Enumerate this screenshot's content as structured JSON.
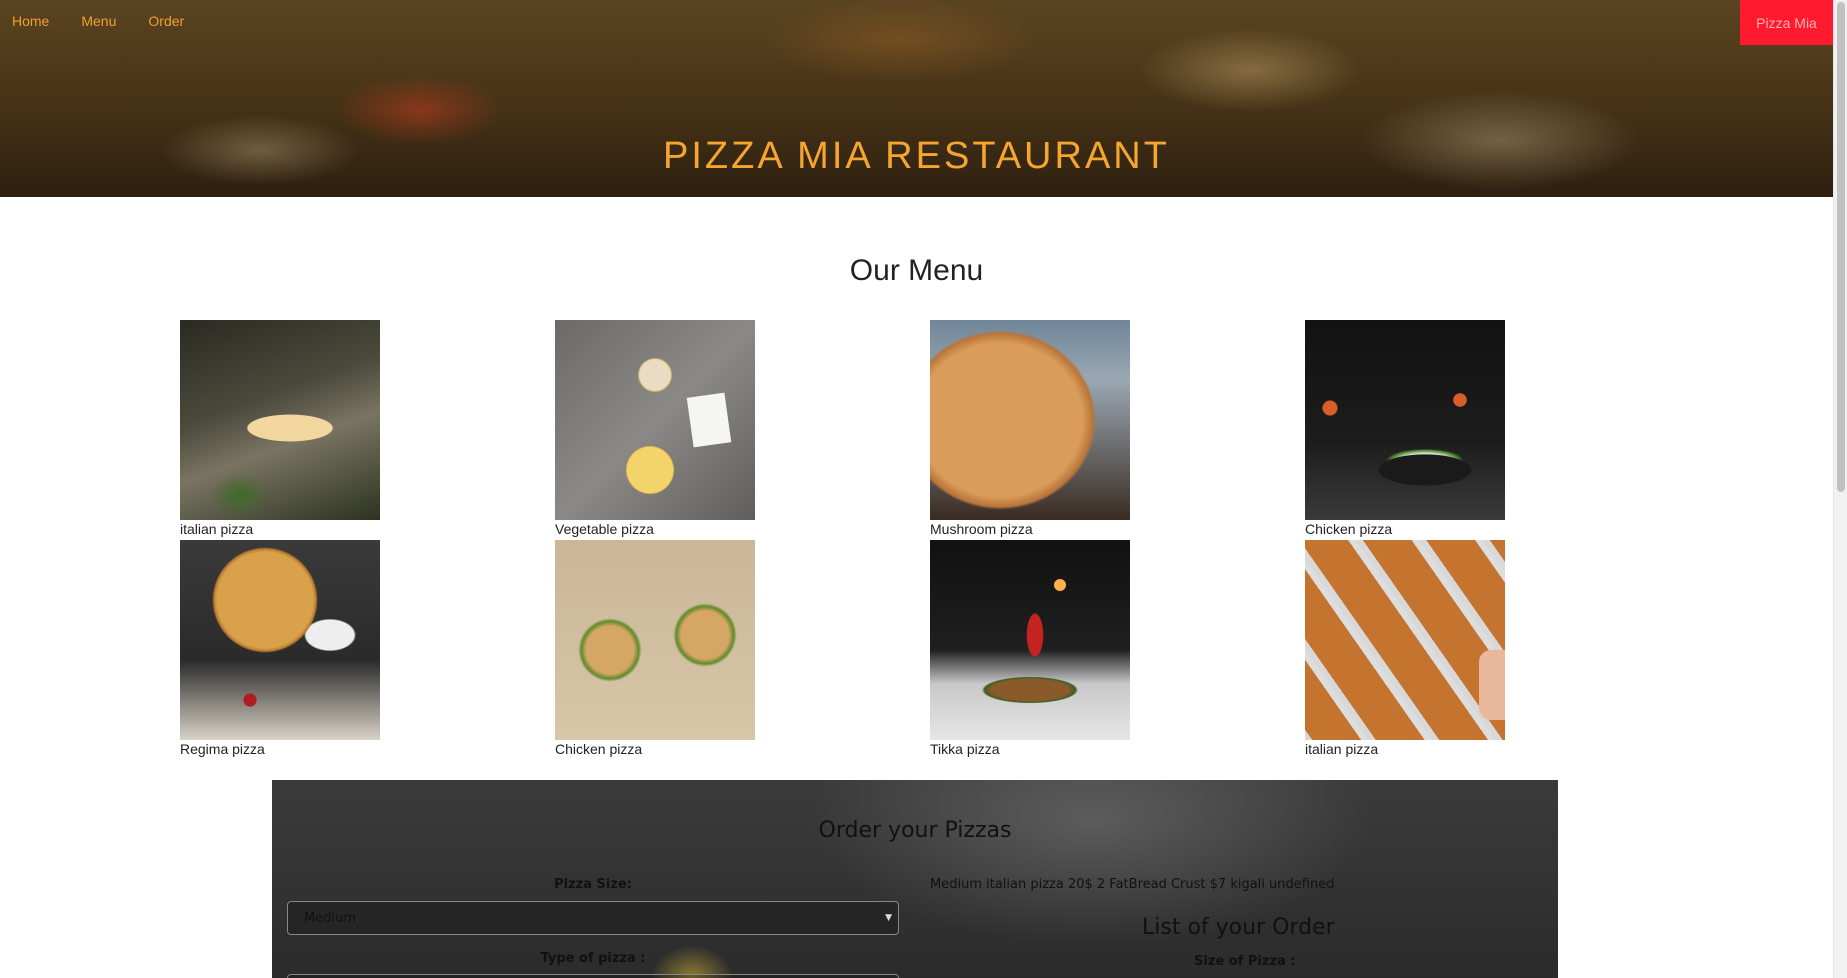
{
  "nav": {
    "links": [
      {
        "label": "Home"
      },
      {
        "label": "Menu"
      },
      {
        "label": "Order"
      }
    ],
    "brand": "Pizza Mia"
  },
  "hero": {
    "title": "PIZZA MIA RESTAURANT"
  },
  "menu": {
    "title": "Our Menu",
    "items": [
      {
        "caption": "italian pizza"
      },
      {
        "caption": "Vegetable pizza"
      },
      {
        "caption": "Mushroom pizza"
      },
      {
        "caption": "Chicken pizza"
      },
      {
        "caption": "Regima pizza"
      },
      {
        "caption": "Chicken pizza"
      },
      {
        "caption": "Tikka pizza"
      },
      {
        "caption": "italian pizza"
      }
    ]
  },
  "order": {
    "title": "Order your Pizzas",
    "size_label": "Pizza Size:",
    "size_value": "Medium",
    "type_label": "Type of pizza :",
    "summary": "Medium italian pizza 20$ 2 FatBread Crust $7 kigali undefined",
    "list_title": "List of your Order",
    "list_size_label": "Size of Pizza :"
  },
  "colors": {
    "accent": "#f5a530",
    "brand_bg": "#ff1a2e"
  }
}
